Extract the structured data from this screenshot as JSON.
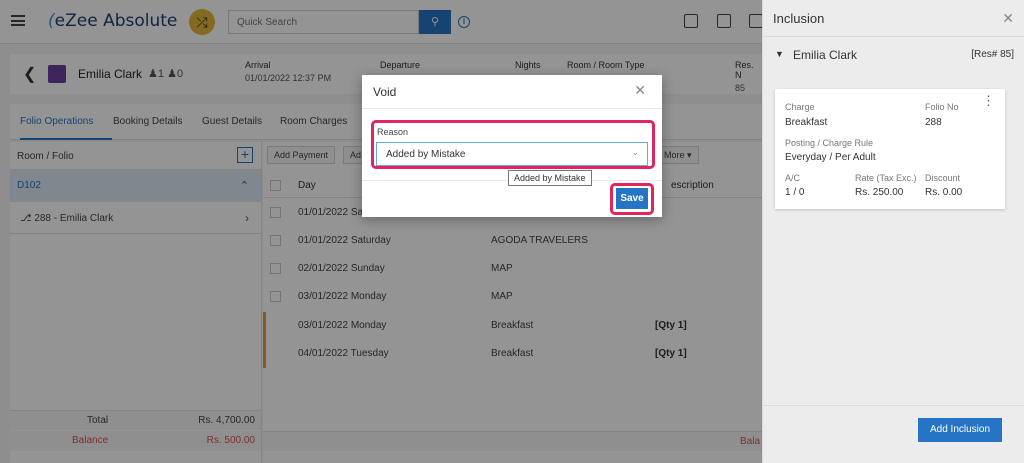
{
  "app": {
    "logo": "eZee Absolute",
    "search_placeholder": "Quick Search"
  },
  "guest": {
    "name": "Emilia Clark",
    "adults": "1",
    "children": "0",
    "arrival_label": "Arrival",
    "arrival_value": "01/01/2022 12:37 PM",
    "departure_label": "Departure",
    "nights_label": "Nights",
    "room_type_label": "Room / Room Type",
    "res_label": "Res. N",
    "res_value": "85"
  },
  "tabs": [
    {
      "label": "Folio Operations"
    },
    {
      "label": "Booking Details"
    },
    {
      "label": "Guest Details"
    },
    {
      "label": "Room Charges"
    }
  ],
  "left_panel": {
    "header": "Room / Folio",
    "room": "D102",
    "folio": "288 - Emilia Clark",
    "total_label": "Total",
    "total_value": "Rs. 4,700.00",
    "balance_label": "Balance",
    "balance_value": "Rs. 500.00"
  },
  "toolbar": {
    "add_payment": "Add Payment",
    "add_partial": "Ad",
    "more": "More"
  },
  "grid": {
    "headers": {
      "day": "Day",
      "description": "escription"
    },
    "rows": [
      {
        "day": "01/01/2022 Sa",
        "desc": "",
        "qty": ""
      },
      {
        "day": "01/01/2022 Saturday",
        "desc": "AGODA TRAVELERS",
        "qty": ""
      },
      {
        "day": "02/01/2022 Sunday",
        "desc": "MAP",
        "qty": ""
      },
      {
        "day": "03/01/2022 Monday",
        "desc": "MAP",
        "qty": ""
      },
      {
        "day": "03/01/2022 Monday",
        "desc": "Breakfast",
        "qty": "[Qty 1]"
      },
      {
        "day": "04/01/2022 Tuesday",
        "desc": "Breakfast",
        "qty": "[Qty 1]"
      }
    ],
    "footer_balance": "Bala"
  },
  "inclusion_panel": {
    "title": "Inclusion",
    "guest_name": "Emilia Clark",
    "res_no": "[Res# 85]",
    "card": {
      "charge_label": "Charge",
      "charge_value": "Breakfast",
      "folio_label": "Folio No",
      "folio_value": "288",
      "posting_label": "Posting / Charge Rule",
      "posting_value": "Everyday / Per Adult",
      "ac_label": "A/C",
      "ac_value": "1 / 0",
      "rate_label": "Rate (Tax Exc.)",
      "rate_value": "Rs. 250.00",
      "discount_label": "Discount",
      "discount_value": "Rs. 0.00"
    },
    "add_button": "Add Inclusion"
  },
  "modal": {
    "title": "Void",
    "reason_label": "Reason",
    "reason_value": "Added by Mistake",
    "tooltip": "Added by Mistake",
    "save_label": "Save"
  },
  "colors": {
    "primary": "#2574c5",
    "highlight": "#e0245e",
    "danger": "#d9534f",
    "accent": "#e4b63b"
  }
}
